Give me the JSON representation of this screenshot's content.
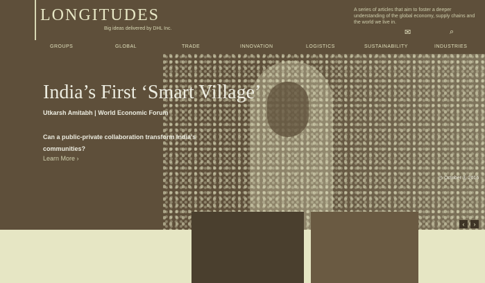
{
  "header": {
    "logo": "LONGITUDES",
    "tagline": "Big ideas delivered by DHL Inc.",
    "blurb": "A series of articles that aim to foster a deeper understanding of the global economy, supply chains and the world we live in.",
    "mail_icon": "mail-icon",
    "search_icon": "search-icon"
  },
  "nav": {
    "items": [
      "GROUPS",
      "GLOBAL",
      "TRADE",
      "INNOVATION",
      "LOGISTICS",
      "SUSTAINABILITY",
      "INDUSTRIES"
    ]
  },
  "hero": {
    "title": "India’s First ‘Smart Village’",
    "byline": "Utkarsh Amitabh | World Economic Forum",
    "excerpt": "Can a public-private collaboration transform India’s communities?",
    "more": "Learn More ›",
    "date": "October 3, 2016",
    "prev": "‹",
    "next": "›"
  }
}
